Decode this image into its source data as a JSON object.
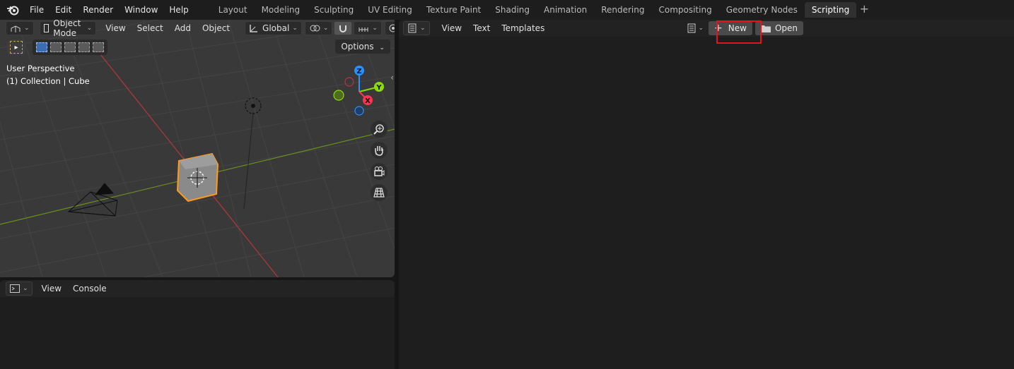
{
  "menu": [
    "File",
    "Edit",
    "Render",
    "Window",
    "Help"
  ],
  "workspaces": {
    "tabs": [
      "Layout",
      "Modeling",
      "Sculpting",
      "UV Editing",
      "Texture Paint",
      "Shading",
      "Animation",
      "Rendering",
      "Compositing",
      "Geometry Nodes",
      "Scripting"
    ],
    "active": "Scripting"
  },
  "viewport": {
    "mode": "Object Mode",
    "menus": [
      "View",
      "Select",
      "Add",
      "Object"
    ],
    "transform_orientation": "Global",
    "options_label": "Options",
    "info_line1": "User Perspective",
    "info_line2": "(1) Collection | Cube",
    "gizmo": {
      "z": "Z",
      "y": "Y",
      "x": "X"
    }
  },
  "console": {
    "menus": [
      "View",
      "Console"
    ]
  },
  "text_editor": {
    "menus": [
      "View",
      "Text",
      "Templates"
    ],
    "new_label": "New",
    "open_label": "Open"
  },
  "colors": {
    "accent_active_object": "#ff9a1f",
    "highlight_box": "#e5141b",
    "axis_x": "#ff3352",
    "axis_y": "#8bdc00",
    "axis_z": "#2890ff"
  }
}
